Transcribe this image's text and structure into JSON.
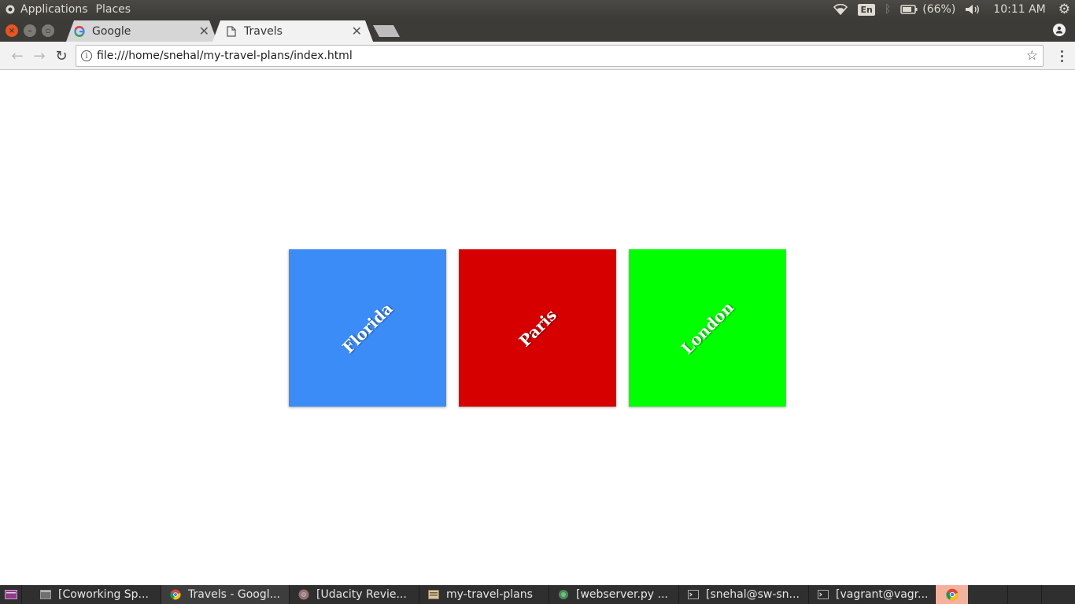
{
  "top_panel": {
    "menus": [
      "Applications",
      "Places"
    ],
    "language": "En",
    "battery": "(66%)",
    "clock": "10:11 AM"
  },
  "browser": {
    "tabs": [
      {
        "title": "Google",
        "active": false
      },
      {
        "title": "Travels",
        "active": true
      }
    ],
    "address": "file:///home/snehal/my-travel-plans/index.html"
  },
  "page": {
    "cards": [
      {
        "label": "Florida",
        "color": "#3c8cf8"
      },
      {
        "label": "Paris",
        "color": "#d60000"
      },
      {
        "label": "London",
        "color": "#00ff00"
      }
    ]
  },
  "taskbar": {
    "items": [
      {
        "label": "[Coworking Sp...",
        "icon": "window-icon"
      },
      {
        "label": "Travels - Googl...",
        "icon": "chrome-icon"
      },
      {
        "label": "[Udacity Revie...",
        "icon": "chrome-icon"
      },
      {
        "label": "my-travel-plans",
        "icon": "folder-icon"
      },
      {
        "label": "[webserver.py ...",
        "icon": "editor-icon"
      },
      {
        "label": "[snehal@sw-sn...",
        "icon": "terminal-icon"
      },
      {
        "label": "[vagrant@vagr...",
        "icon": "terminal-icon"
      }
    ]
  },
  "colors": {
    "panel": "#3c3b37",
    "close_button": "#e95420"
  }
}
